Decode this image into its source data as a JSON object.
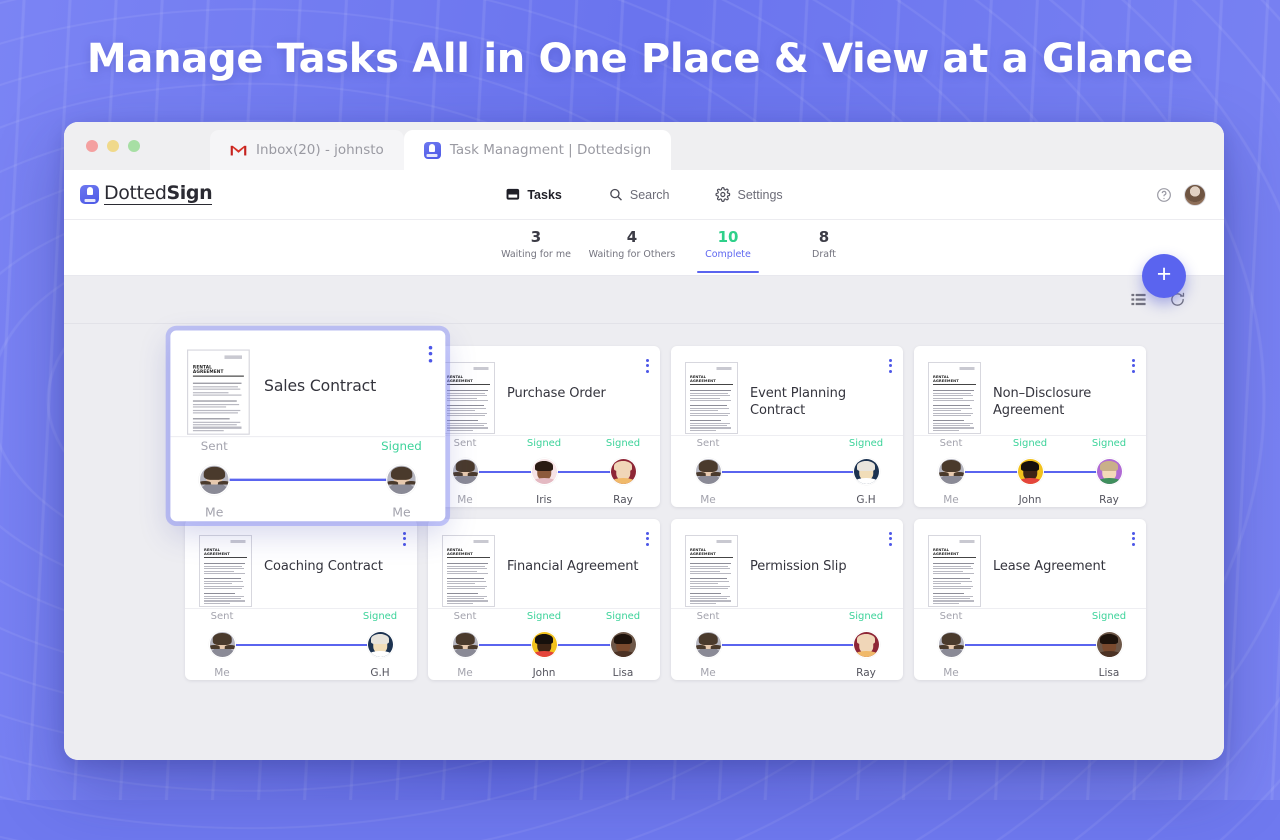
{
  "hero": {
    "title": "Manage Tasks All in One Place & View at a Glance"
  },
  "browser": {
    "tabs": [
      {
        "label": "Inbox(20) - johnsto",
        "icon": "gmail-icon",
        "active": false
      },
      {
        "label": "Task Managment | Dottedsign",
        "icon": "dottedsign-icon",
        "active": true
      }
    ]
  },
  "app": {
    "brand": {
      "name_light": "Dotted",
      "name_bold": "Sign",
      "icon": "dottedsign-logo-icon"
    },
    "nav": [
      {
        "label": "Tasks",
        "icon": "tasks-icon",
        "active": true
      },
      {
        "label": "Search",
        "icon": "search-icon",
        "active": false
      },
      {
        "label": "Settings",
        "icon": "gear-icon",
        "active": false
      }
    ],
    "help_icon": "help-circle-icon",
    "avatar": "user-avatar"
  },
  "status_tabs": [
    {
      "count": "3",
      "label": "Waiting for me",
      "active": false
    },
    {
      "count": "4",
      "label": "Waiting for Others",
      "active": false
    },
    {
      "count": "10",
      "label": "Complete",
      "active": true
    },
    {
      "count": "8",
      "label": "Draft",
      "active": false
    }
  ],
  "toolbar": {
    "list_view_icon": "list-view-icon",
    "refresh_icon": "refresh-icon",
    "fab_label": "+"
  },
  "thumbnail": {
    "heading": "RENTAL AGREEMENT"
  },
  "colors": {
    "accent": "#5a64ef",
    "signed": "#3dd39a",
    "sent": "#a3a3ad",
    "backdrop": "#6f79ef",
    "canvas": "#ededf1"
  },
  "cards": [
    {
      "title": "Sales Contract",
      "highlighted": true,
      "signers": [
        {
          "status": "Sent",
          "name": "Me",
          "type": "me"
        },
        {
          "status": "Signed",
          "name": "Me",
          "type": "me"
        }
      ]
    },
    {
      "title": "Purchase Order",
      "highlighted": false,
      "signers": [
        {
          "status": "Sent",
          "name": "Me",
          "type": "me"
        },
        {
          "status": "Signed",
          "name": "Iris",
          "type": "person",
          "bg": "#f6e3e6",
          "skin": "#8d5a3c",
          "hair": "#2a1a12",
          "shirt": "#e4b9c2"
        },
        {
          "status": "Signed",
          "name": "Ray",
          "type": "person",
          "bg": "#8e2636",
          "skin": "#f0d6b8",
          "hair": "#f0d6b8",
          "shirt": "#f0b96a"
        }
      ]
    },
    {
      "title": "Event Planning Contract",
      "highlighted": false,
      "signers": [
        {
          "status": "Sent",
          "name": "Me",
          "type": "me"
        },
        {
          "status": "Signed",
          "name": "G.H",
          "type": "person",
          "bg": "#1c3250",
          "skin": "#f1ddb8",
          "hair": "#e8e4dc",
          "shirt": "#ffffff"
        }
      ]
    },
    {
      "title": "Non–Disclosure Agreement",
      "highlighted": false,
      "signers": [
        {
          "status": "Sent",
          "name": "Me",
          "type": "me"
        },
        {
          "status": "Signed",
          "name": "John",
          "type": "person",
          "bg": "#f2c21c",
          "skin": "#3d2415",
          "hair": "#16100c",
          "shirt": "#e4453c"
        },
        {
          "status": "Signed",
          "name": "Ray",
          "type": "person",
          "bg": "#b06ad4",
          "skin": "#f3d9b9",
          "hair": "#c9b089",
          "shirt": "#3f8f5d"
        }
      ]
    },
    {
      "title": "Coaching Contract",
      "highlighted": false,
      "signers": [
        {
          "status": "Sent",
          "name": "Me",
          "type": "me"
        },
        {
          "status": "Signed",
          "name": "G.H",
          "type": "person",
          "bg": "#1c3250",
          "skin": "#f1ddb8",
          "hair": "#e8e4dc",
          "shirt": "#ffffff"
        }
      ]
    },
    {
      "title": "Financial Agreement",
      "highlighted": false,
      "signers": [
        {
          "status": "Sent",
          "name": "Me",
          "type": "me"
        },
        {
          "status": "Signed",
          "name": "John",
          "type": "person",
          "bg": "#f2c21c",
          "skin": "#3d2415",
          "hair": "#16100c",
          "shirt": "#e4453c"
        },
        {
          "status": "Signed",
          "name": "Lisa",
          "type": "person",
          "bg": "#6d5748",
          "skin": "#7a4a2e",
          "hair": "#1d120b",
          "shirt": "#4c3224"
        }
      ]
    },
    {
      "title": "Permission Slip",
      "highlighted": false,
      "signers": [
        {
          "status": "Sent",
          "name": "Me",
          "type": "me"
        },
        {
          "status": "Signed",
          "name": "Ray",
          "type": "person",
          "bg": "#8e2636",
          "skin": "#f0d6b8",
          "hair": "#f0d6b8",
          "shirt": "#f0b96a"
        }
      ]
    },
    {
      "title": "Lease Agreement",
      "highlighted": false,
      "signers": [
        {
          "status": "Sent",
          "name": "Me",
          "type": "me"
        },
        {
          "status": "Signed",
          "name": "Lisa",
          "type": "person",
          "bg": "#6d5748",
          "skin": "#7a4a2e",
          "hair": "#1d120b",
          "shirt": "#4c3224"
        }
      ]
    }
  ]
}
